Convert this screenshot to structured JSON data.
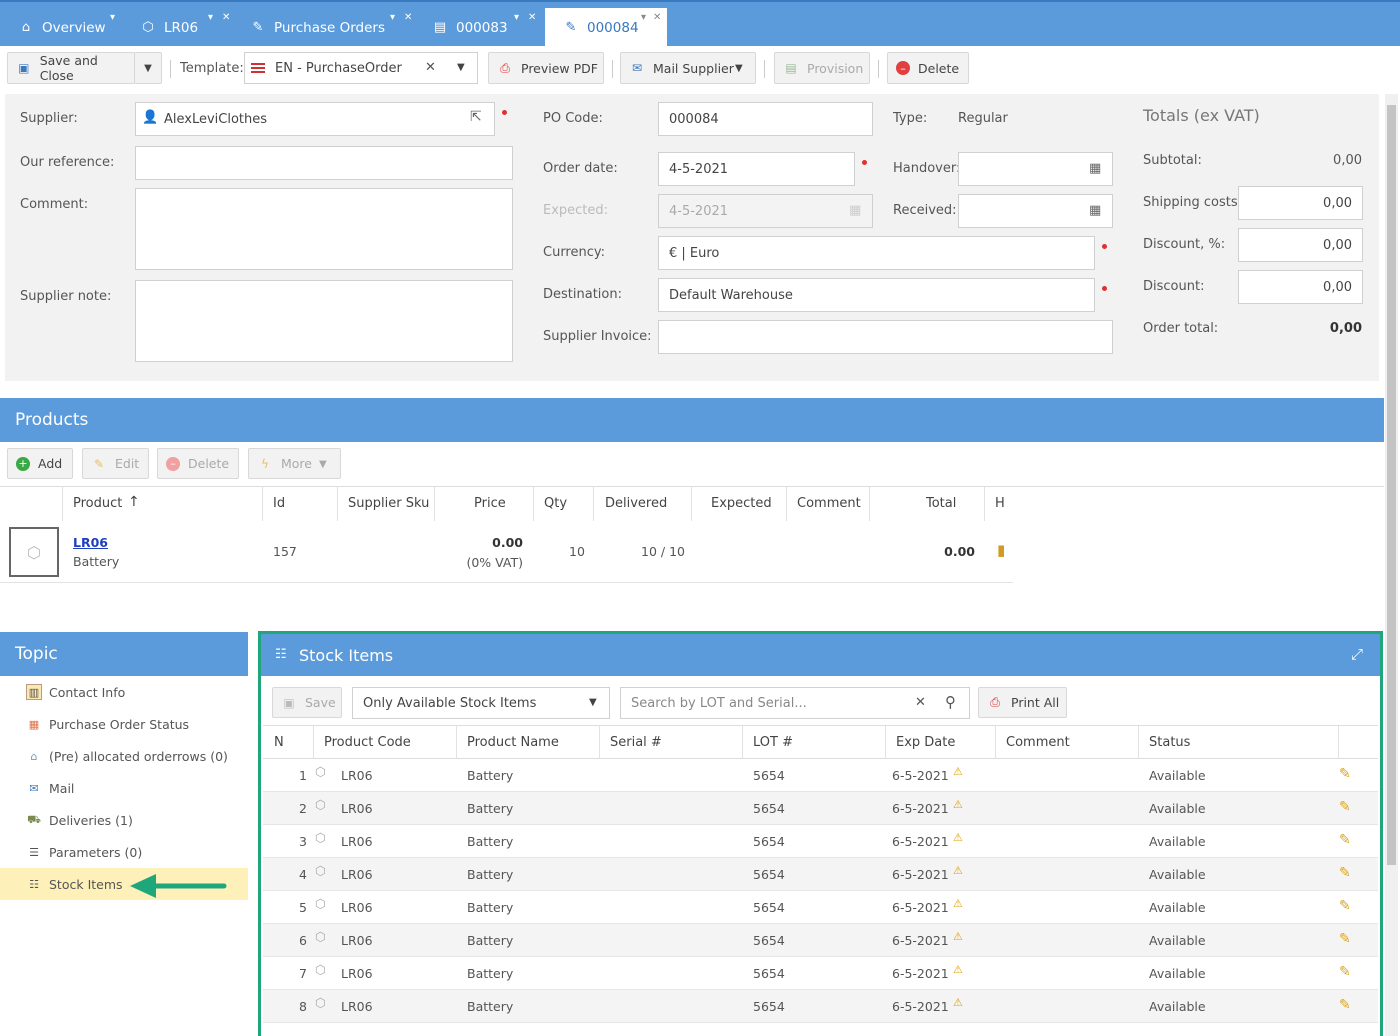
{
  "tabs": [
    {
      "label": "Overview",
      "icon": "home-icon"
    },
    {
      "label": "LR06",
      "icon": "cube-icon"
    },
    {
      "label": "Purchase Orders",
      "icon": "order-icon"
    },
    {
      "label": "000083",
      "icon": "order-icon"
    },
    {
      "label": "000084",
      "icon": "order-icon",
      "active": true
    }
  ],
  "toolbar": {
    "save_close": "Save and Close",
    "template_label": "Template:",
    "template_value": "EN - PurchaseOrder",
    "preview_pdf": "Preview PDF",
    "mail_supplier": "Mail Supplier",
    "provision": "Provision",
    "delete": "Delete"
  },
  "form": {
    "supplier_label": "Supplier:",
    "supplier_value": "AlexLeviClothes",
    "our_reference_label": "Our reference:",
    "our_reference_value": "",
    "comment_label": "Comment:",
    "comment_value": "",
    "supplier_note_label": "Supplier note:",
    "supplier_note_value": "",
    "po_code_label": "PO Code:",
    "po_code_value": "000084",
    "order_date_label": "Order date:",
    "order_date_value": "4-5-2021",
    "expected_label": "Expected:",
    "expected_value": "4-5-2021",
    "currency_label": "Currency:",
    "currency_value": "€ | Euro",
    "destination_label": "Destination:",
    "destination_value": "Default Warehouse",
    "supplier_invoice_label": "Supplier Invoice:",
    "supplier_invoice_value": "",
    "type_label": "Type:",
    "type_value": "Regular",
    "handover_label": "Handover:",
    "handover_value": "",
    "received_label": "Received:",
    "received_value": ""
  },
  "totals": {
    "title": "Totals (ex VAT)",
    "subtotal_label": "Subtotal:",
    "subtotal_value": "0,00",
    "shipping_label": "Shipping costs:",
    "shipping_value": "0,00",
    "discount_pct_label": "Discount, %:",
    "discount_pct_value": "0,00",
    "discount_label": "Discount:",
    "discount_value": "0,00",
    "order_total_label": "Order total:",
    "order_total_value": "0,00"
  },
  "products": {
    "title": "Products",
    "buttons": {
      "add": "Add",
      "edit": "Edit",
      "delete": "Delete",
      "more": "More"
    },
    "columns": {
      "product": "Product",
      "id": "Id",
      "supplier_sku": "Supplier Sku",
      "price": "Price",
      "qty": "Qty",
      "delivered": "Delivered",
      "expected": "Expected",
      "comment": "Comment",
      "total": "Total",
      "h": "H"
    },
    "row": {
      "code": "LR06",
      "name": "Battery",
      "id": "157",
      "price": "0.00",
      "vat": "(0% VAT)",
      "qty": "10",
      "delivered": "10 / 10",
      "total": "0.00"
    }
  },
  "topic": {
    "title": "Topic",
    "items": [
      {
        "label": "Contact Info",
        "icon": "contact-icon"
      },
      {
        "label": "Purchase Order Status",
        "icon": "status-grid-icon"
      },
      {
        "label": "(Pre) allocated orderrows (0)",
        "icon": "basket-icon"
      },
      {
        "label": "Mail",
        "icon": "mail-icon"
      },
      {
        "label": "Deliveries (1)",
        "icon": "truck-icon"
      },
      {
        "label": "Parameters (0)",
        "icon": "parameters-icon"
      },
      {
        "label": "Stock Items",
        "icon": "list-icon",
        "active": true
      }
    ]
  },
  "stock": {
    "title": "Stock Items",
    "save": "Save",
    "filter_value": "Only Available Stock Items",
    "search_placeholder": "Search by LOT and Serial...",
    "print_all": "Print All",
    "columns": {
      "n": "N",
      "product_code": "Product Code",
      "product_name": "Product Name",
      "serial": "Serial #",
      "lot": "LOT #",
      "exp_date": "Exp Date",
      "comment": "Comment",
      "status": "Status"
    },
    "rows": [
      {
        "n": "1",
        "code": "LR06",
        "name": "Battery",
        "serial": "",
        "lot": "5654",
        "exp": "6-5-2021",
        "comment": "",
        "status": "Available"
      },
      {
        "n": "2",
        "code": "LR06",
        "name": "Battery",
        "serial": "",
        "lot": "5654",
        "exp": "6-5-2021",
        "comment": "",
        "status": "Available"
      },
      {
        "n": "3",
        "code": "LR06",
        "name": "Battery",
        "serial": "",
        "lot": "5654",
        "exp": "6-5-2021",
        "comment": "",
        "status": "Available"
      },
      {
        "n": "4",
        "code": "LR06",
        "name": "Battery",
        "serial": "",
        "lot": "5654",
        "exp": "6-5-2021",
        "comment": "",
        "status": "Available"
      },
      {
        "n": "5",
        "code": "LR06",
        "name": "Battery",
        "serial": "",
        "lot": "5654",
        "exp": "6-5-2021",
        "comment": "",
        "status": "Available"
      },
      {
        "n": "6",
        "code": "LR06",
        "name": "Battery",
        "serial": "",
        "lot": "5654",
        "exp": "6-5-2021",
        "comment": "",
        "status": "Available"
      },
      {
        "n": "7",
        "code": "LR06",
        "name": "Battery",
        "serial": "",
        "lot": "5654",
        "exp": "6-5-2021",
        "comment": "",
        "status": "Available"
      },
      {
        "n": "8",
        "code": "LR06",
        "name": "Battery",
        "serial": "",
        "lot": "5654",
        "exp": "6-5-2021",
        "comment": "",
        "status": "Available"
      }
    ]
  },
  "colors": {
    "header_blue": "#5b9bdc",
    "highlight": "#fdf0b8",
    "arrow_green": "#1fa67a",
    "frame_green": "#1fa67a"
  }
}
